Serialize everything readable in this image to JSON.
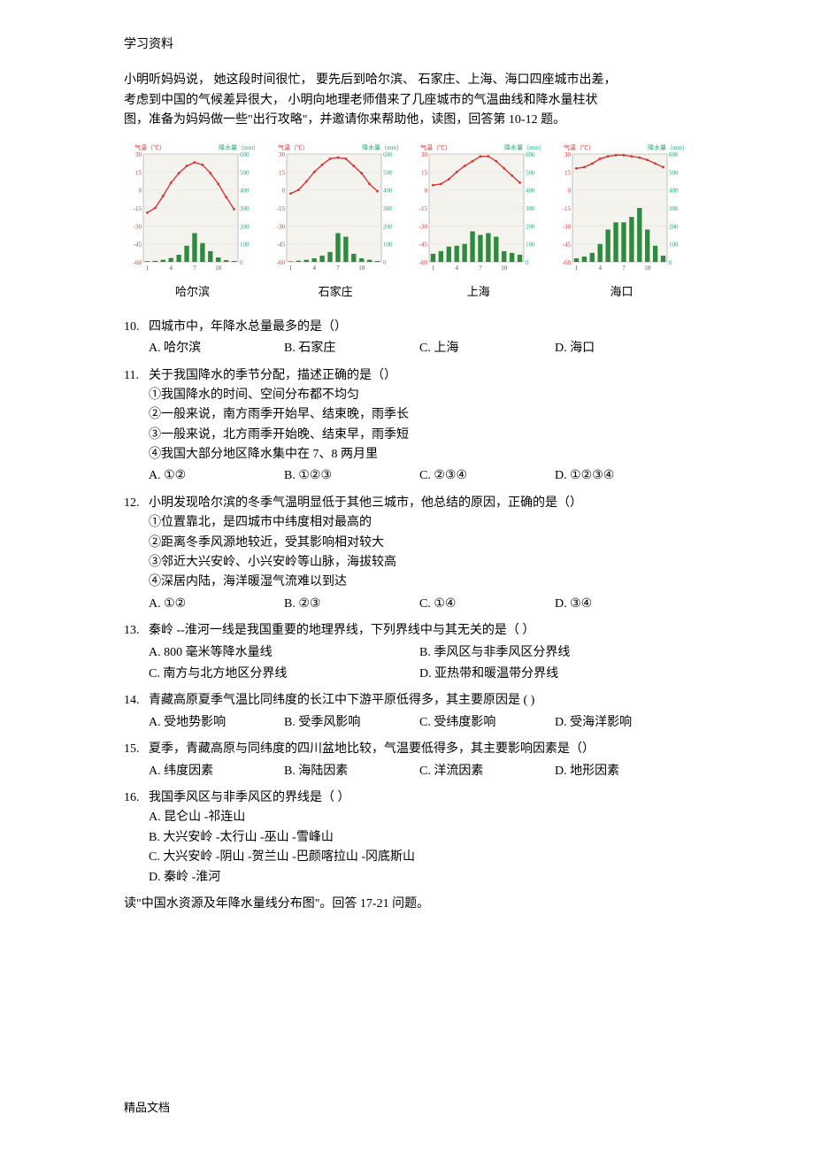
{
  "header": "学习资料",
  "intro_lines": [
    "小明听妈妈说，  她这段时间很忙，  要先后到哈尔滨、 石家庄、上海、海口四座城市出差，",
    "考虑到中国的气候差异很大，    小明向地理老师借来了几座城市的气温曲线和降水量柱状",
    "图，准备为妈妈做一些\"出行攻略\"，并邀请你来帮助他，读图，回答第      10-12 题。"
  ],
  "chart_data": [
    {
      "type": "combo",
      "city": "哈尔滨",
      "title_left": "气温（℃）",
      "title_right": "降水量（mm）",
      "x": [
        1,
        2,
        3,
        4,
        5,
        6,
        7,
        8,
        9,
        10,
        11,
        12
      ],
      "temp": [
        -19,
        -15,
        -5,
        6,
        14,
        20,
        23,
        21,
        14,
        5,
        -6,
        -16
      ],
      "precip": [
        4,
        6,
        12,
        22,
        40,
        90,
        160,
        105,
        60,
        25,
        10,
        5
      ],
      "y1_ticks": [
        30,
        15,
        0,
        -15,
        -30,
        -45,
        -60
      ],
      "y2_ticks": [
        600,
        500,
        400,
        300,
        200,
        100,
        0
      ]
    },
    {
      "type": "combo",
      "city": "石家庄",
      "title_left": "气温（℃）",
      "title_right": "降水量（mm）",
      "x": [
        1,
        2,
        3,
        4,
        5,
        6,
        7,
        8,
        9,
        10,
        11,
        12
      ],
      "temp": [
        -3,
        0,
        7,
        15,
        21,
        26,
        27,
        26,
        20,
        14,
        5,
        -1
      ],
      "precip": [
        3,
        7,
        12,
        20,
        35,
        55,
        160,
        140,
        45,
        20,
        12,
        5
      ],
      "y1_ticks": [
        30,
        15,
        0,
        -15,
        -30,
        -45,
        -60
      ],
      "y2_ticks": [
        600,
        500,
        400,
        300,
        200,
        100,
        0
      ]
    },
    {
      "type": "combo",
      "city": "上海",
      "title_left": "气温（℃）",
      "title_right": "降水量（mm）",
      "x": [
        1,
        2,
        3,
        4,
        5,
        6,
        7,
        8,
        9,
        10,
        11,
        12
      ],
      "temp": [
        4,
        5,
        9,
        15,
        20,
        24,
        28,
        28,
        24,
        18,
        12,
        6
      ],
      "precip": [
        45,
        60,
        85,
        90,
        100,
        170,
        150,
        160,
        140,
        60,
        50,
        40
      ],
      "y1_ticks": [
        30,
        15,
        0,
        -15,
        -30,
        -45,
        -60
      ],
      "y2_ticks": [
        600,
        500,
        400,
        300,
        200,
        100,
        0
      ]
    },
    {
      "type": "combo",
      "city": "海口",
      "title_left": "气温（℃）",
      "title_right": "降水量（mm）",
      "x": [
        1,
        2,
        3,
        4,
        5,
        6,
        7,
        8,
        9,
        10,
        11,
        12
      ],
      "temp": [
        18,
        19,
        22,
        26,
        28,
        29,
        29,
        28,
        27,
        25,
        22,
        19
      ],
      "precip": [
        20,
        30,
        50,
        100,
        180,
        220,
        220,
        250,
        300,
        180,
        90,
        35
      ],
      "y1_ticks": [
        30,
        15,
        0,
        -15,
        -30,
        -45,
        -60
      ],
      "y2_ticks": [
        600,
        500,
        400,
        300,
        200,
        100,
        0
      ]
    }
  ],
  "questions": {
    "q10": {
      "num": "10.",
      "text": "四城市中，年降水总量最多的是（）",
      "opts": {
        "A": "A. 哈尔滨",
        "B": "B. 石家庄",
        "C": "C. 上海",
        "D": "D. 海口"
      }
    },
    "q11": {
      "num": "11.",
      "text": "关于我国降水的季节分配，描述正确的是（）",
      "s1": "①我国降水的时间、空间分布都不均匀",
      "s2": "②一般来说，南方雨季开始早、结束晚，雨季长",
      "s3": "③一般来说，北方雨季开始晚、结束早，雨季短",
      "s4": "④我国大部分地区降水集中在    7、8 两月里",
      "opts": {
        "A": "A. ①②",
        "B": "B. ①②③",
        "C": "C. ②③④",
        "D": "D. ①②③④"
      }
    },
    "q12": {
      "num": "12.",
      "text": "小明发现哈尔滨的冬季气温明显低于其他三城市，他总结的原因，正确的是（）",
      "s1": "①位置靠北，是四城市中纬度相对最高的",
      "s2": "②距离冬季风源地较近，受其影响相对较大",
      "s3": "③邻近大兴安岭、小兴安岭等山脉，海拔较高",
      "s4": "④深居内陆，海洋暖湿气流难以到达",
      "opts": {
        "A": "A. ①②",
        "B": "B. ②③",
        "C": "C. ①④",
        "D": "D. ③④"
      }
    },
    "q13": {
      "num": "13.",
      "text": "秦岭 --淮河一线是我国重要的地理界线，下列界线中与其无关的是（            ）",
      "opts": {
        "A": "A. 800 毫米等降水量线",
        "B": "B. 季风区与非季风区分界线",
        "C": "C. 南方与北方地区分界线",
        "D": "D. 亚热带和暖温带分界线"
      }
    },
    "q14": {
      "num": "14.",
      "text": "青藏高原夏季气温比同纬度的长江中下游平原低得多，其主要原因是       ( )",
      "opts": {
        "A": "A. 受地势影响",
        "B": "B. 受季风影响",
        "C": "C. 受纬度影响",
        "D": "D. 受海洋影响"
      }
    },
    "q15": {
      "num": "15.",
      "text": "夏季，青藏高原与同纬度的四川盆地比较，气温要低得多，其主要影响因素是（）",
      "opts": {
        "A": "A. 纬度因素",
        "B": "B. 海陆因素",
        "C": "C. 洋流因素",
        "D": "D. 地形因素"
      }
    },
    "q16": {
      "num": "16.",
      "text": "我国季风区与非季风区的界线是（        ）",
      "optA": "A. 昆仑山 -祁连山",
      "optB": "B. 大兴安岭 -太行山 -巫山 -雪峰山",
      "optC": "C. 大兴安岭 -阴山 -贺兰山 -巴颜喀拉山 -冈底斯山",
      "optD": "D. 秦岭 -淮河"
    },
    "post": "读\"中国水资源及年降水量线分布图\"。回答     17-21 问题。"
  },
  "footer": "精品文档"
}
